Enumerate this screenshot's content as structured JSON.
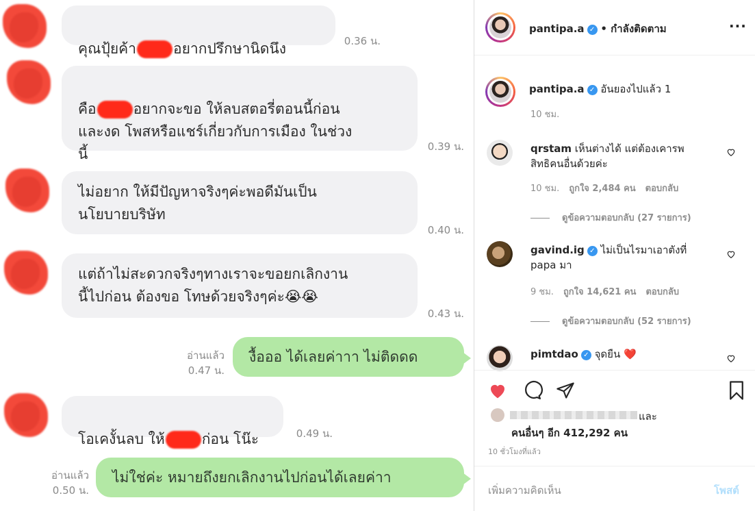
{
  "chat": {
    "messages": [
      {
        "dir": "in",
        "text_a": "คุณปุ้ยค้า",
        "text_b": "อยากปรึกษานิดนึง",
        "time": "0.36 น."
      },
      {
        "dir": "in",
        "text_a": "คือ",
        "text_b": "อยากจะขอ ให้ลบสตอรี่ตอนนี้ก่อน\nและงด โพสหรือแชร์เกี่ยวกับการเมือง ในช่วง\nนี้",
        "time": "0.39 น."
      },
      {
        "dir": "in",
        "text": "ไม่อยาก ให้มีปัญหาจริงๆค่ะพอดีมันเป็น\nนโยบายบริษัท",
        "time": "0.40 น."
      },
      {
        "dir": "in",
        "text": "แต่ถ้าไม่สะดวกจริงๆทางเราจะขอยกเลิกงาน\nนี้ไปก่อน ต้องขอ โทษด้วยจริงๆค่ะ😭😭",
        "time": "0.43 น."
      },
      {
        "dir": "out",
        "text": "งื้อออ ได้เลยค่าาา ไม่ติดดด",
        "read": "อ่านแล้ว",
        "time": "0.47 น."
      },
      {
        "dir": "in",
        "text_a": "โอเคงั้นลบ ให้",
        "text_b": "ก่อน โน๊ะ",
        "time": "0.49 น."
      },
      {
        "dir": "out",
        "text": "ไม่ใช่ค่ะ หมายถึงยกเลิกงานไปก่อนได้เลยค่าา",
        "read": "อ่านแล้ว",
        "time": "0.50 น."
      }
    ]
  },
  "instagram": {
    "header": {
      "username": "pantipa.a",
      "status": "• กำลังติดตาม",
      "more": "···"
    },
    "caption": {
      "username": "pantipa.a",
      "text": "อันยองไปแล้ว 1",
      "time": "10 ชม."
    },
    "comments": [
      {
        "username": "qrstam",
        "verified": false,
        "text": "เห็นต่างได้ แต่ต้องเคารพ\nสิทธิคนอื่นด้วยค่ะ",
        "time": "10 ชม.",
        "likes": "ถูกใจ 2,484 คน",
        "reply": "ตอบกลับ",
        "view_replies": "ดูข้อความตอบกลับ (27 รายการ)"
      },
      {
        "username": "gavind.ig",
        "verified": true,
        "text": "ไม่เป็นไรมาเอาตังที่\npapa มา",
        "time": "9 ชม.",
        "likes": "ถูกใจ 14,621 คน",
        "reply": "ตอบกลับ",
        "view_replies": "ดูข้อความตอบกลับ (52 รายการ)"
      },
      {
        "username": "pimtdao",
        "verified": true,
        "text": "จุดยืน ❤️"
      }
    ],
    "likes_line1": "และ",
    "likes_line2": "คนอื่นๆ อีก 412,292 คน",
    "post_time": "10 ชั่วโมงที่แล้ว",
    "comment_placeholder": "เพิ่มความคิดเห็น",
    "post_button": "โพสต์",
    "colors": {
      "like_red": "#ed4956",
      "verified_blue": "#3897f0",
      "link_blue": "#b2dffc"
    }
  }
}
